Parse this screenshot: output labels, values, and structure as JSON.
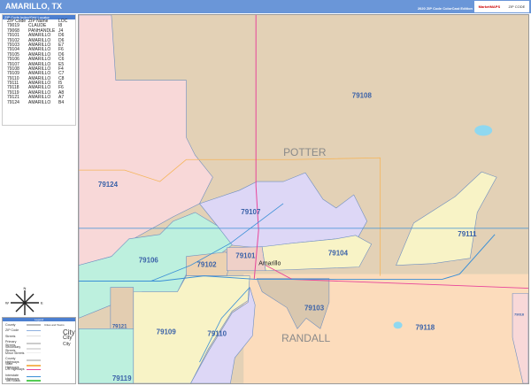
{
  "header": {
    "title": "AMARILLO, TX",
    "edition": "2020 ZIP Code ColorCast Edition",
    "logo_text": "MarketMAPS",
    "logo_sub": "ZIP CODE"
  },
  "zip_index": {
    "title": "ZIP Code Index/Grid Locator",
    "columns": [
      "ZIP Code",
      "ZIP Name",
      "LOC"
    ],
    "rows": [
      [
        "79019",
        "CLAUDE",
        "I8"
      ],
      [
        "79068",
        "PANHANDLE",
        "J4"
      ],
      [
        "79101",
        "AMARILLO",
        "D6"
      ],
      [
        "79102",
        "AMARILLO",
        "D6"
      ],
      [
        "79103",
        "AMARILLO",
        "E7"
      ],
      [
        "79104",
        "AMARILLO",
        "F6"
      ],
      [
        "79105",
        "AMARILLO",
        "D6"
      ],
      [
        "79106",
        "AMARILLO",
        "C6"
      ],
      [
        "79107",
        "AMARILLO",
        "E5"
      ],
      [
        "79108",
        "AMARILLO",
        "F4"
      ],
      [
        "79109",
        "AMARILLO",
        "C7"
      ],
      [
        "79110",
        "AMARILLO",
        "C8"
      ],
      [
        "79111",
        "AMARILLO",
        "I5"
      ],
      [
        "79118",
        "AMARILLO",
        "F6"
      ],
      [
        "79119",
        "AMARILLO",
        "A8"
      ],
      [
        "79121",
        "AMARILLO",
        "A7"
      ],
      [
        "79124",
        "AMARILLO",
        "B4"
      ]
    ]
  },
  "compass": {
    "n": "N",
    "s": "S",
    "e": "E",
    "w": "W"
  },
  "legend": {
    "title": "Legend",
    "items": [
      {
        "label": "County",
        "color": "#bbbbbb"
      },
      {
        "label": "ZIP Code",
        "color": "#8fb0e0"
      },
      {
        "label": "Streets",
        "color": "#dddddd"
      },
      {
        "label": "Primary Streets",
        "color": "#cccccc"
      },
      {
        "label": "Secondary Streets",
        "color": "#dddddd"
      },
      {
        "label": "Minor Streets",
        "color": "#eeeeee"
      },
      {
        "label": "County Highways",
        "color": "#cccccc"
      },
      {
        "label": "State Highways",
        "color": "#f5b55a"
      },
      {
        "label": "US Highways",
        "color": "#e8459a"
      },
      {
        "label": "Interstate Highways",
        "color": "#3a8fd6"
      },
      {
        "label": "Toll Roads",
        "color": "#55cc55"
      }
    ],
    "cities_title": "Cities and Towns",
    "city_label": "City"
  },
  "map": {
    "counties": [
      "POTTER",
      "RANDALL"
    ],
    "city": "Amarillo",
    "zips": [
      "79108",
      "79124",
      "79107",
      "79111",
      "79106",
      "79102",
      "79101",
      "79104",
      "79103",
      "79118",
      "79109",
      "79110",
      "79121",
      "79119",
      "79016"
    ],
    "colors": {
      "tan": "#e3d1b6",
      "pink": "#f8d8d8",
      "lavender": "#ddd7f6",
      "teal": "#bdf0de",
      "yellow": "#f8f3c6",
      "peach": "#fcdcbc",
      "grey_tan": "#d9c7ae",
      "water": "#8fd8f0",
      "interstate": "#3a8fd6",
      "us_hwy": "#e8459a",
      "state_hwy": "#f5b55a"
    }
  }
}
